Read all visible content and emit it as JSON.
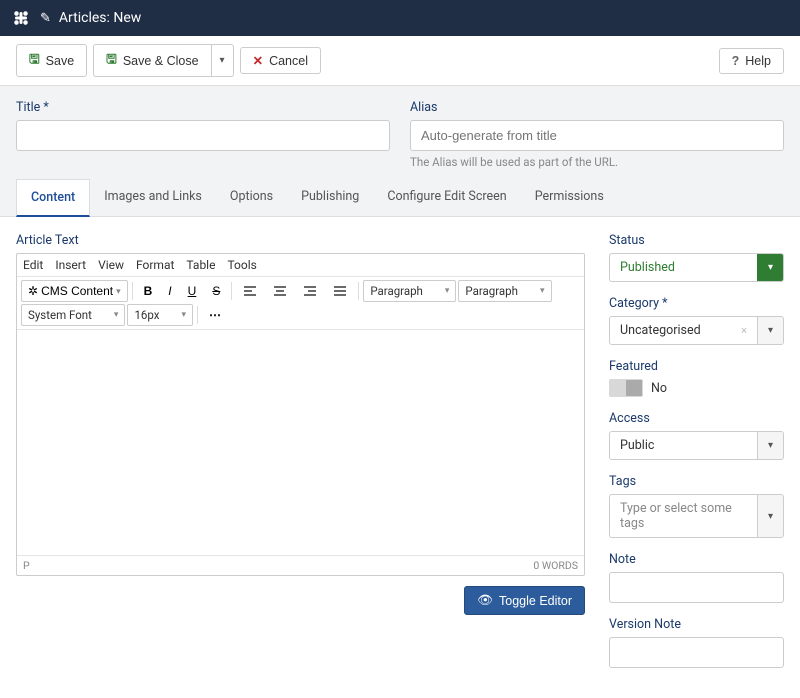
{
  "header": {
    "title": "Articles: New"
  },
  "toolbar": {
    "save": "Save",
    "save_close": "Save & Close",
    "cancel": "Cancel",
    "help": "Help"
  },
  "form": {
    "title_label": "Title *",
    "alias_label": "Alias",
    "alias_placeholder": "Auto-generate from title",
    "alias_help": "The Alias will be used as part of the URL."
  },
  "tabs": [
    "Content",
    "Images and Links",
    "Options",
    "Publishing",
    "Configure Edit Screen",
    "Permissions"
  ],
  "editor": {
    "section_label": "Article Text",
    "menubar": [
      "Edit",
      "Insert",
      "View",
      "Format",
      "Table",
      "Tools"
    ],
    "cms_button": "CMS Content",
    "block_format1": "Paragraph",
    "block_format2": "Paragraph",
    "font_family": "System Font",
    "font_size": "16px",
    "status_path": "P",
    "status_words": "0 WORDS",
    "toggle": "Toggle Editor"
  },
  "side": {
    "status": {
      "label": "Status",
      "value": "Published"
    },
    "category": {
      "label": "Category *",
      "value": "Uncategorised"
    },
    "featured": {
      "label": "Featured",
      "value": "No"
    },
    "access": {
      "label": "Access",
      "value": "Public"
    },
    "tags": {
      "label": "Tags",
      "placeholder": "Type or select some tags"
    },
    "note": {
      "label": "Note"
    },
    "version_note": {
      "label": "Version Note"
    }
  }
}
